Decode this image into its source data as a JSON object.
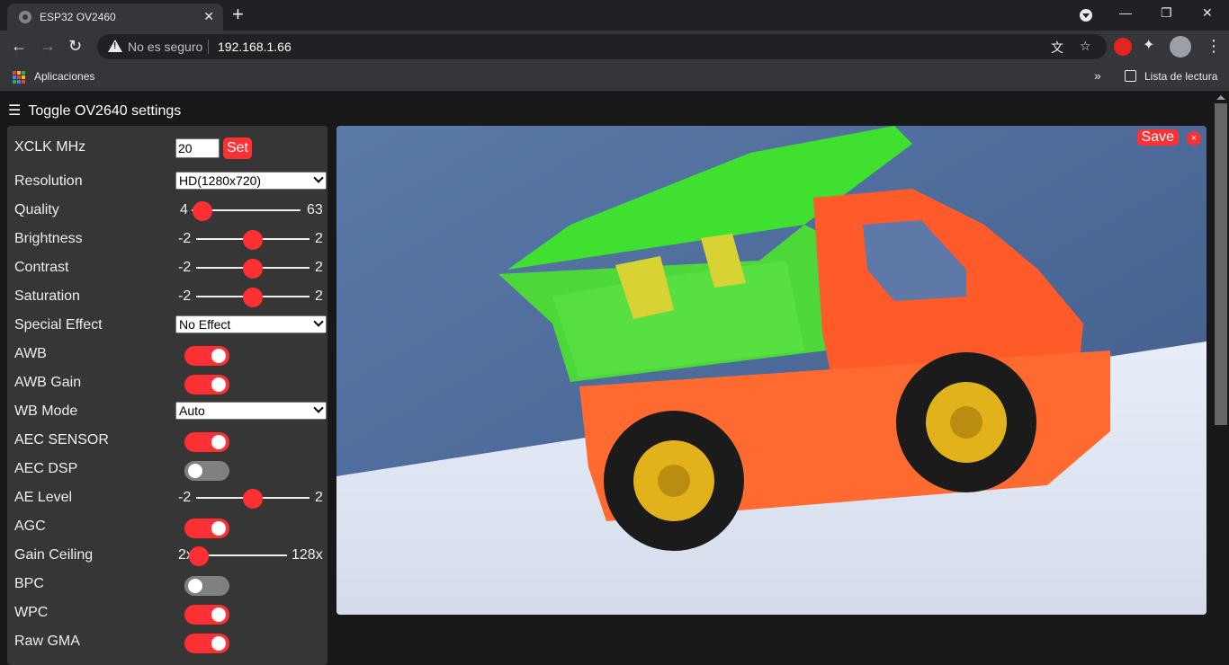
{
  "browser": {
    "tab_title": "ESP32 OV2460",
    "tab_close": "✕",
    "new_tab": "+",
    "security_text": "No es seguro",
    "url": "192.168.1.66",
    "bookmark_apps": "Aplicaciones",
    "bookmark_more": "»",
    "reading_list": "Lista de lectura",
    "window_min": "—",
    "window_restore": "❐",
    "window_close": "✕",
    "back": "←",
    "forward": "→",
    "reload": "↻",
    "menu": "⋮"
  },
  "page": {
    "toggle_label": "Toggle OV2640 settings",
    "hamburger": "☰"
  },
  "settings": {
    "xclk": {
      "label": "XCLK MHz",
      "value": "20",
      "button": "Set"
    },
    "resolution": {
      "label": "Resolution",
      "value": "HD(1280x720)"
    },
    "quality": {
      "label": "Quality",
      "min": "4",
      "max": "63",
      "level": 0.1
    },
    "brightness": {
      "label": "Brightness",
      "min": "-2",
      "max": "2",
      "level": 0.5
    },
    "contrast": {
      "label": "Contrast",
      "min": "-2",
      "max": "2",
      "level": 0.5
    },
    "saturation": {
      "label": "Saturation",
      "min": "-2",
      "max": "2",
      "level": 0.5
    },
    "special_effect": {
      "label": "Special Effect",
      "value": "No Effect"
    },
    "awb": {
      "label": "AWB",
      "on": true
    },
    "awb_gain": {
      "label": "AWB Gain",
      "on": true
    },
    "wb_mode": {
      "label": "WB Mode",
      "value": "Auto"
    },
    "aec_sensor": {
      "label": "AEC SENSOR",
      "on": true
    },
    "aec_dsp": {
      "label": "AEC DSP",
      "on": false
    },
    "ae_level": {
      "label": "AE Level",
      "min": "-2",
      "max": "2",
      "level": 0.5
    },
    "agc": {
      "label": "AGC",
      "on": true
    },
    "gain_ceiling": {
      "label": "Gain Ceiling",
      "min": "2x",
      "max": "128x",
      "level": 0.0
    },
    "bpc": {
      "label": "BPC",
      "on": false
    },
    "wpc": {
      "label": "WPC",
      "on": true
    },
    "raw_gma": {
      "label": "Raw GMA",
      "on": true
    }
  },
  "stream": {
    "save_label": "Save",
    "close_label": "×"
  },
  "colors": {
    "accent": "#ff3034",
    "panel": "#363636",
    "background": "#181818"
  }
}
